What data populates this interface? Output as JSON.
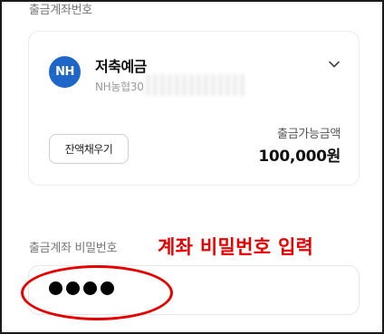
{
  "withdrawal_account": {
    "section_label": "출금계좌번호",
    "bank_logo_text": "NH",
    "account_name": "저축예금",
    "account_number_visible": "NH농협30",
    "balance_button_label": "잔액채우기",
    "available_label": "출금가능금액",
    "available_amount": "100,000원",
    "expand_icon": "chevron-down-icon"
  },
  "password": {
    "label": "출금계좌 비밀번호",
    "entered_digits": 4
  },
  "annotation": {
    "text": "계좌 비밀번호 입력",
    "color": "#e60000"
  },
  "colors": {
    "bank_logo_bg": "#1f66c9",
    "annotation_red": "#e50000"
  }
}
